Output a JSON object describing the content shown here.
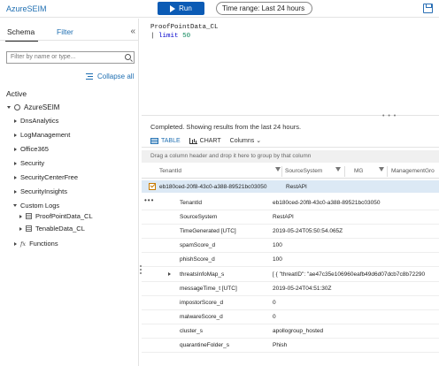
{
  "header": {
    "app_title": "AzureSEIM",
    "run_label": "Run",
    "time_range_label": "Time range: Last 24 hours"
  },
  "left_panel": {
    "tabs": [
      "Schema",
      "Filter"
    ],
    "collapse_icon": "«",
    "filter_placeholder": "Filter by name or type...",
    "collapse_all_label": "Collapse all",
    "section": "Active",
    "workspace": "AzureSEIM",
    "items": [
      "DnsAnalytics",
      "LogManagement",
      "Office365",
      "Security",
      "SecurityCenterFree",
      "SecurityInsights",
      "Custom Logs",
      "ProofPointData_CL",
      "TenableData_CL",
      "Functions"
    ]
  },
  "editor": {
    "line1": "ProofPointData_CL",
    "line2_pipe": "|",
    "line2_kw": "limit",
    "line2_num": "50"
  },
  "results": {
    "status": "Completed. Showing results from the last 24 hours.",
    "views": {
      "table": "TABLE",
      "chart": "CHART",
      "columns": "Columns"
    },
    "group_hint": "Drag a column header and drop it here to group by that column",
    "columns": [
      "TenantId",
      "SourceSystem",
      "MG",
      "ManagementGro"
    ],
    "row": {
      "tenant": "eb180ced-20f8-43c0-a388-89521bc03050",
      "source": "RestAPI"
    },
    "details": [
      {
        "key": "TenantId",
        "value": "eb180ced-20f8-43c0-a388-89521bc03050"
      },
      {
        "key": "SourceSystem",
        "value": "RestAPI"
      },
      {
        "key": "TimeGenerated [UTC]",
        "value": "2019-05-24T05:50:54.065Z"
      },
      {
        "key": "spamScore_d",
        "value": "100"
      },
      {
        "key": "phishScore_d",
        "value": "100"
      },
      {
        "key": "threatsInfoMap_s",
        "value": "[ { \"threatID\": \"ae47c35e106960eafb49d6d07dcb7c8b72290"
      },
      {
        "key": "messageTime_t [UTC]",
        "value": "2019-05-24T04:51:30Z"
      },
      {
        "key": "impostorScore_d",
        "value": "0"
      },
      {
        "key": "malwareScore_d",
        "value": "0"
      },
      {
        "key": "cluster_s",
        "value": "apollogroup_hosted"
      },
      {
        "key": "quarantineFolder_s",
        "value": "Phish"
      }
    ]
  },
  "colors": {
    "accent": "#0b5bb5",
    "link": "#1f6fb2",
    "selected_row": "#dce9f5"
  }
}
